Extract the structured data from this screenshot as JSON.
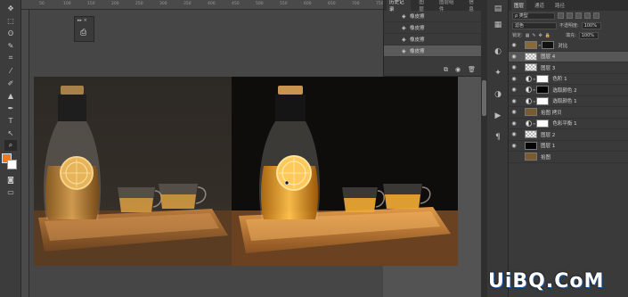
{
  "ruler": {
    "ticks": [
      "50",
      "100",
      "150",
      "200",
      "250",
      "300",
      "350",
      "400",
      "450",
      "500",
      "550",
      "600",
      "650",
      "700",
      "750"
    ]
  },
  "mini_panel": {
    "header": "▸▸ ×"
  },
  "history": {
    "tabs": [
      "历史记录",
      "图层",
      "图层组件",
      "信息"
    ],
    "items": [
      {
        "label": "橡皮擦"
      },
      {
        "label": "橡皮擦"
      },
      {
        "label": "橡皮擦"
      },
      {
        "label": "橡皮擦"
      }
    ]
  },
  "layers_panel": {
    "tabs": [
      "图层",
      "通道",
      "路径"
    ],
    "filter_label": "ρ 类型",
    "blend_mode": "滤色",
    "opacity_label": "不透明度:",
    "opacity_value": "100%",
    "lock_label": "锁定:",
    "fill_label": "填充:",
    "fill_value": "100%",
    "layers": [
      {
        "name": "对比",
        "thumb": "#8a6a3a",
        "mask": "#111",
        "type": "pixel",
        "visible": true,
        "selected": false
      },
      {
        "name": "图层 4",
        "thumb": "#cccccc",
        "mask": null,
        "type": "pixel",
        "visible": true,
        "selected": true
      },
      {
        "name": "图层 3",
        "thumb": "#d0d0d0",
        "mask": null,
        "type": "pixel",
        "visible": true,
        "selected": false
      },
      {
        "name": "色阶 1",
        "thumb": null,
        "mask": "#ffffff",
        "type": "adjustment",
        "visible": true,
        "selected": false
      },
      {
        "name": "选取颜色 2",
        "thumb": null,
        "mask": "#000000",
        "type": "adjustment",
        "visible": true,
        "selected": false
      },
      {
        "name": "选取颜色 1",
        "thumb": null,
        "mask": "#ffffff",
        "type": "adjustment",
        "visible": true,
        "selected": false
      },
      {
        "name": "拾图 拷贝",
        "thumb": "#7a5a30",
        "mask": null,
        "type": "pixel",
        "visible": true,
        "selected": false
      },
      {
        "name": "色彩平衡 1",
        "thumb": null,
        "mask": "#ffffff",
        "type": "adjustment",
        "visible": true,
        "selected": false
      },
      {
        "name": "图层 2",
        "thumb": "#d0d0d0",
        "mask": null,
        "type": "pixel",
        "visible": true,
        "selected": false
      },
      {
        "name": "图层 1",
        "thumb": "#050505",
        "mask": null,
        "type": "pixel",
        "visible": true,
        "selected": false
      },
      {
        "name": "拾图",
        "thumb": "#7a5a30",
        "mask": null,
        "type": "pixel",
        "visible": false,
        "selected": false
      }
    ]
  },
  "watermark": {
    "text": "UiBQ.CoM"
  },
  "colors": {
    "foreground": "#f07a1a",
    "background": "#ffffff",
    "accent": "#1a6fd0"
  }
}
